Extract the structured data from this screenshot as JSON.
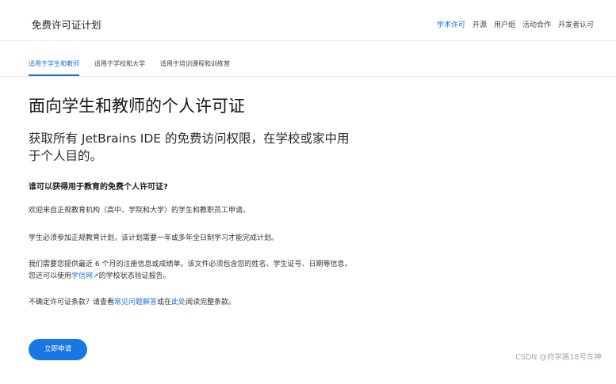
{
  "header": {
    "brand": "免费许可证计划",
    "nav": [
      {
        "label": "学术许可",
        "active": true
      },
      {
        "label": "开源",
        "active": false
      },
      {
        "label": "用户组",
        "active": false
      },
      {
        "label": "活动合作",
        "active": false
      },
      {
        "label": "开发者认可",
        "active": false
      }
    ]
  },
  "subnav": {
    "tabs": [
      {
        "label": "适用于学生和教师",
        "active": true
      },
      {
        "label": "适用于学校和大学",
        "active": false
      },
      {
        "label": "适用于培训课程和训练营",
        "active": false
      }
    ]
  },
  "main": {
    "title": "面向学生和教师的个人许可证",
    "lead": "获取所有 JetBrains IDE 的免费访问权限，在学校或家中用于个人目的。",
    "heading": "谁可以获得用于教育的免费个人许可证?",
    "p1": "欢迎来自正规教育机构（高中、学院和大学）的学生和教职员工申请。",
    "p2": "学生必须参加正规教育计划，该计划需要一年或多年全日制学习才能完成计划。",
    "p3_before": "我们需要您提供最近 6 个月的注册信息或成绩单。该文件必须包含您的姓名、学生证号、日期等信息。您还可以使用",
    "p3_link": "学信网↗",
    "p3_after": "的学校状态验证报告。",
    "p4_before": "不确定许可证条款？请查看",
    "p4_link1": "常见问题解答",
    "p4_middle": "或在",
    "p4_link2": "此处",
    "p4_after": "阅读完整条款。",
    "apply_label": "立即申请"
  },
  "watermark": "CSDN @府学路18号车神",
  "colors": {
    "accent": "#1c6fd8",
    "button": "#1976e5"
  }
}
